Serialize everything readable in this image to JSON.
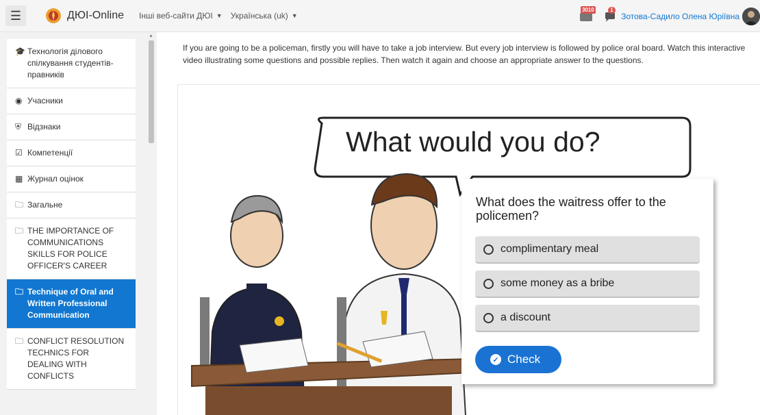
{
  "navbar": {
    "brand": "ДЮІ-Online",
    "menu_sites": "Інші веб-сайти ДЮІ",
    "menu_lang": "Українська (uk)",
    "notifications_count": "3010",
    "messages_count": "1",
    "user_name": "Зотова-Садило Олена Юріївна"
  },
  "drawer": {
    "items": [
      {
        "label": "Технологія ділового спілкування студентів-правників",
        "icon": "graduation-cap-icon"
      },
      {
        "label": "Учасники",
        "icon": "users-icon"
      },
      {
        "label": "Відзнаки",
        "icon": "shield-icon"
      },
      {
        "label": "Компетенції",
        "icon": "checkbox-icon"
      },
      {
        "label": "Журнал оцінок",
        "icon": "table-icon"
      },
      {
        "label": "Загальне",
        "icon": "folder-icon"
      },
      {
        "label": "THE IMPORTANCE OF COMMUNICATIONS SKILLS FOR POLICE OFFICER'S CAREER",
        "icon": "folder-icon"
      },
      {
        "label": "Technique of Oral and Written Professional Communication",
        "icon": "folder-icon",
        "active": true
      },
      {
        "label": "CONFLICT RESOLUTION TECHNICS FOR DEALING WITH CONFLICTS",
        "icon": "folder-icon"
      }
    ]
  },
  "main": {
    "intro": "If you are going to be a policeman, firstly you will have to take a job interview. But every job interview is followed by police oral board. Watch this interactive video illustrating some questions and possible replies. Then watch it again and choose an appropriate answer to the questions.",
    "video": {
      "bubble_text": "What would you do?"
    },
    "quiz": {
      "question": "What does the waitress offer to the policemen?",
      "options": [
        "complimentary meal",
        "some money as a bribe",
        "a discount"
      ],
      "check_label": "Check"
    }
  },
  "colors": {
    "accent": "#1177d1",
    "badge": "#d9534f",
    "check_button": "#1a73d2"
  }
}
